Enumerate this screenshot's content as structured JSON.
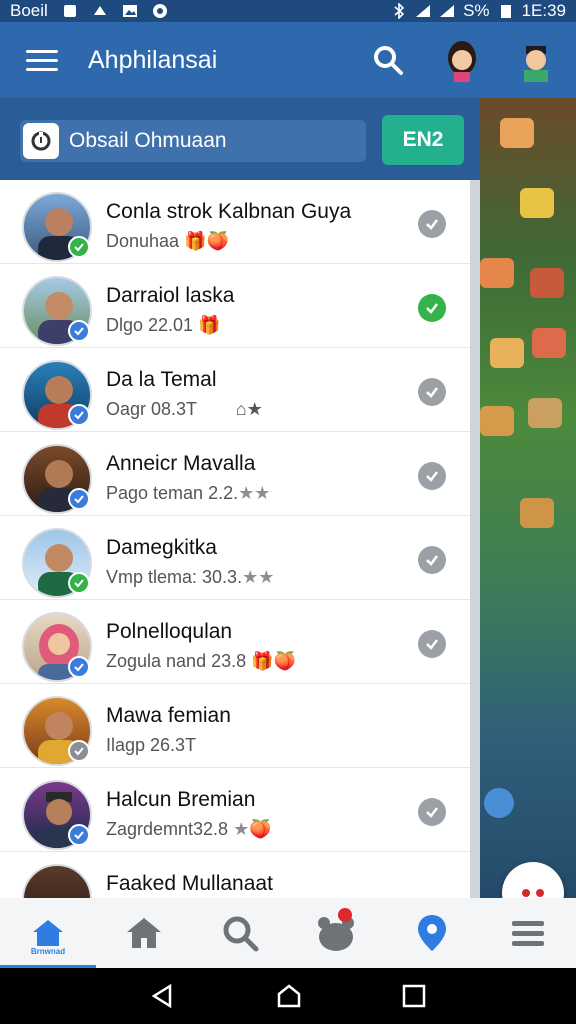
{
  "status_bar": {
    "left_text": "Boeil",
    "battery": "S%",
    "time": "1E:39"
  },
  "app_bar": {
    "title": "Ahphilansai"
  },
  "search": {
    "value": "Obsail Ohmuaan",
    "lang_button": "EN2"
  },
  "contacts": [
    {
      "name": "Conla strok Kalbnan Guya",
      "sub": "Donuhaa",
      "status": "grey",
      "badge": "green"
    },
    {
      "name": "Darraiol laska",
      "sub": "Dlgo 22.01",
      "status": "green",
      "badge": "blue"
    },
    {
      "name": "Da la Temal",
      "sub": "Oagr 08.3T",
      "status": "grey",
      "badge": "blue"
    },
    {
      "name": "Anneicr Mavalla",
      "sub": "Pago teman 2.2.",
      "status": "grey",
      "badge": "blue"
    },
    {
      "name": "Damegkitka",
      "sub": "Vmp tlema: 30.3.",
      "status": "grey",
      "badge": "green"
    },
    {
      "name": "Polnelloqulan",
      "sub": "Zogula nand 23.8",
      "status": "grey",
      "badge": "blue"
    },
    {
      "name": "Mawa femian",
      "sub": "Ilagp 26.3T",
      "status": "none",
      "badge": "grey"
    },
    {
      "name": "Halcun Bremian",
      "sub": "Zagrdemnt32.8",
      "status": "grey",
      "badge": "blue"
    },
    {
      "name": "Faaked Mullanaat",
      "sub": "",
      "status": "none",
      "badge": "none"
    }
  ],
  "bottom_nav": {
    "active_label": "Brnwnad"
  },
  "colors": {
    "primary": "#2f69ad",
    "accent": "#22b08f",
    "green": "#34b34a",
    "nav_active": "#2f7de1"
  }
}
